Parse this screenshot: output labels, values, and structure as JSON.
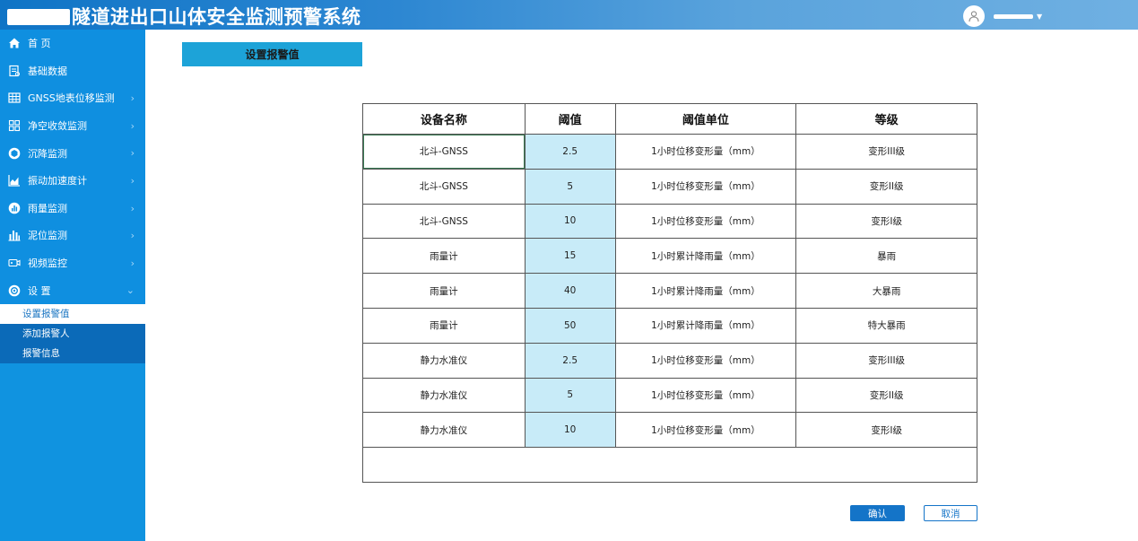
{
  "header": {
    "title": "隧道进出口山体安全监测预警系统",
    "user_name": ""
  },
  "sidebar": {
    "items": [
      {
        "label": "首 页",
        "icon": "home-icon",
        "has_children": false
      },
      {
        "label": "基础数据",
        "icon": "document-icon",
        "has_children": false
      },
      {
        "label": "GNSS地表位移监测",
        "icon": "grid-icon",
        "has_children": true
      },
      {
        "label": "净空收敛监测",
        "icon": "squares-icon",
        "has_children": true
      },
      {
        "label": "沉降监测",
        "icon": "cube-icon",
        "has_children": true
      },
      {
        "label": "振动加速度计",
        "icon": "area-chart-icon",
        "has_children": true
      },
      {
        "label": "雨量监测",
        "icon": "rain-icon",
        "has_children": true
      },
      {
        "label": "泥位监测",
        "icon": "bar-chart-icon",
        "has_children": true
      },
      {
        "label": "视频监控",
        "icon": "camera-icon",
        "has_children": true
      },
      {
        "label": "设 置",
        "icon": "settings-icon",
        "has_children": true
      }
    ],
    "settings_sub": [
      {
        "label": "设置报警值",
        "active": true
      },
      {
        "label": "添加报警人",
        "active": false
      },
      {
        "label": "报警信息",
        "active": false
      }
    ]
  },
  "main": {
    "tab_title": "设置报警值",
    "table": {
      "headers": [
        "设备名称",
        "阈值",
        "阈值单位",
        "等级"
      ],
      "rows": [
        [
          "北斗-GNSS",
          "2.5",
          "1小时位移变形量（mm）",
          "变形III级"
        ],
        [
          "北斗-GNSS",
          "5",
          "1小时位移变形量（mm）",
          "变形II级"
        ],
        [
          "北斗-GNSS",
          "10",
          "1小时位移变形量（mm）",
          "变形I级"
        ],
        [
          "雨量计",
          "15",
          "1小时累计降雨量（mm）",
          "暴雨"
        ],
        [
          "雨量计",
          "40",
          "1小时累计降雨量（mm）",
          "大暴雨"
        ],
        [
          "雨量计",
          "50",
          "1小时累计降雨量（mm）",
          "特大暴雨"
        ],
        [
          "静力水准仪",
          "2.5",
          "1小时位移变形量（mm）",
          "变形III级"
        ],
        [
          "静力水准仪",
          "5",
          "1小时位移变形量（mm）",
          "变形II级"
        ],
        [
          "静力水准仪",
          "10",
          "1小时位移变形量（mm）",
          "变形I级"
        ]
      ]
    },
    "confirm_label": "确认",
    "cancel_label": "取消"
  },
  "colors": {
    "header_start": "#0f74c6",
    "sidebar_bg": "#0f8fe0",
    "submenu_bg": "#0b6ab8",
    "tab_bg": "#1da3d8",
    "threshold_cell_bg": "#c8ebf8",
    "button_primary": "#1474c8"
  }
}
